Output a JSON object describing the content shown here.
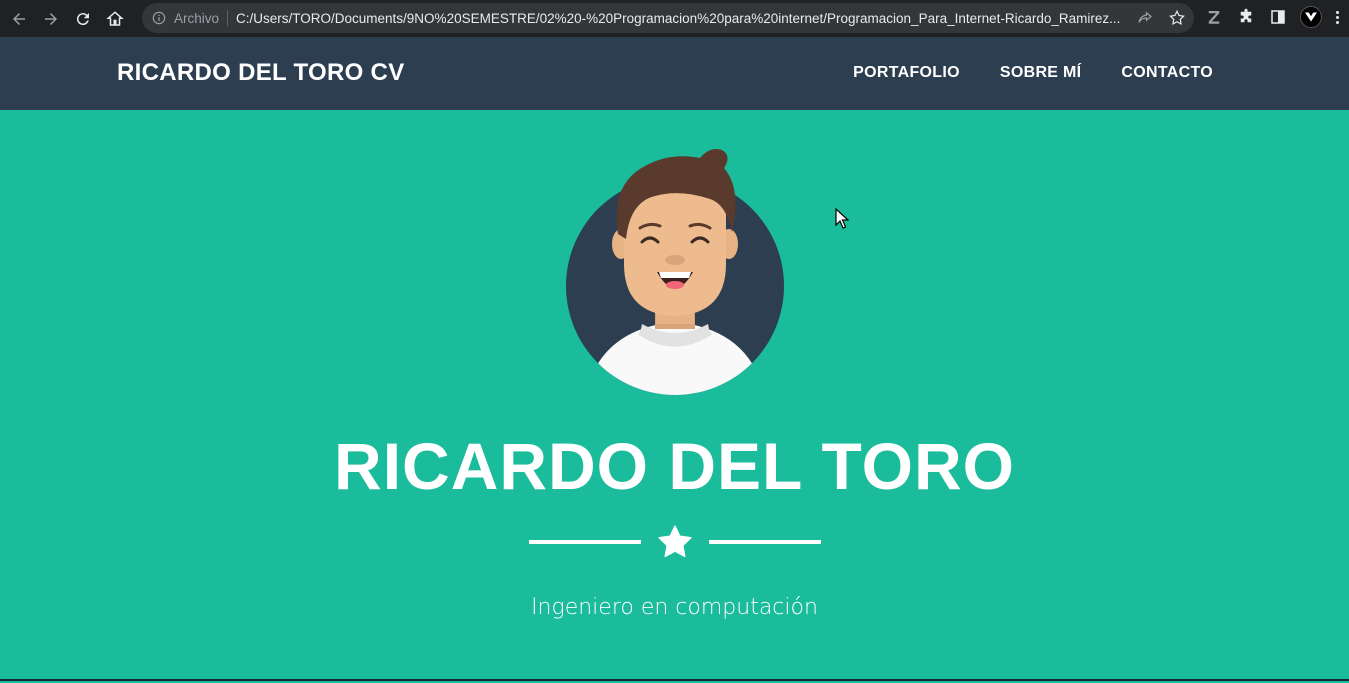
{
  "browser": {
    "scheme_label": "Archivo",
    "url": "C:/Users/TORO/Documents/9NO%20SEMESTRE/02%20-%20Programacion%20para%20internet/Programacion_Para_Internet-Ricardo_Ramirez..."
  },
  "site": {
    "brand": "RICARDO DEL TORO CV",
    "nav": [
      {
        "label": "PORTAFOLIO"
      },
      {
        "label": "SOBRE MÍ"
      },
      {
        "label": "CONTACTO"
      }
    ]
  },
  "hero": {
    "name": "RICARDO DEL TORO",
    "subtitle": "Ingeniero en computación"
  },
  "colors": {
    "navbar": "#2c3e50",
    "hero_bg": "#1abc9c",
    "browser_chrome": "#202124",
    "text": "#ffffff"
  }
}
